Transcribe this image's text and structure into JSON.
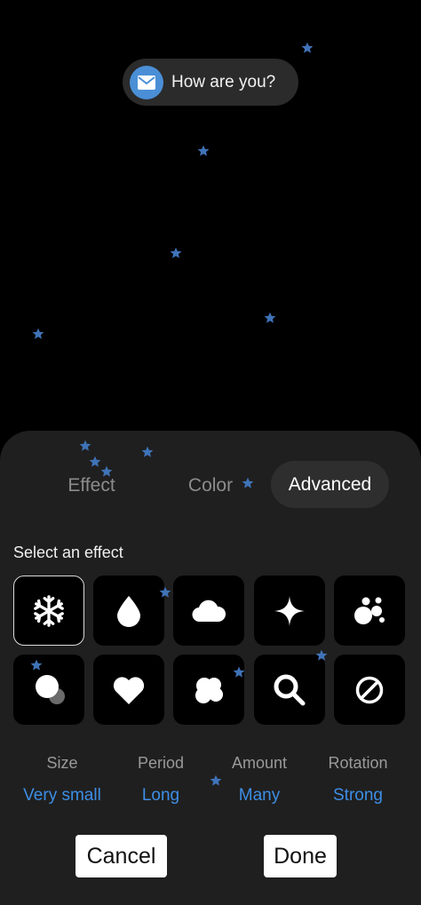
{
  "notification": {
    "icon": "mail-icon",
    "text": "How are you?"
  },
  "tabs": [
    {
      "label": "Effect",
      "active": false
    },
    {
      "label": "Color",
      "active": false
    },
    {
      "label": "Advanced",
      "active": true
    }
  ],
  "section_label": "Select an effect",
  "effects": [
    {
      "icon": "snowflake-icon",
      "selected": true
    },
    {
      "icon": "drop-icon",
      "selected": false
    },
    {
      "icon": "cloud-icon",
      "selected": false
    },
    {
      "icon": "sparkle-icon",
      "selected": false
    },
    {
      "icon": "bubbles-icon",
      "selected": false
    },
    {
      "icon": "circles-icon",
      "selected": false
    },
    {
      "icon": "heart-icon",
      "selected": false
    },
    {
      "icon": "blob-icon",
      "selected": false
    },
    {
      "icon": "magnifier-icon",
      "selected": false
    },
    {
      "icon": "none-icon",
      "selected": false
    }
  ],
  "params": [
    {
      "label": "Size",
      "value": "Very small"
    },
    {
      "label": "Period",
      "value": "Long"
    },
    {
      "label": "Amount",
      "value": "Many"
    },
    {
      "label": "Rotation",
      "value": "Strong"
    }
  ],
  "buttons": {
    "cancel": "Cancel",
    "done": "Done"
  },
  "colors": {
    "accent": "#3d8ee6",
    "star": "#3f73b8",
    "panel": "#1f1f1f",
    "notification_icon_bg": "#4a8fd6"
  }
}
